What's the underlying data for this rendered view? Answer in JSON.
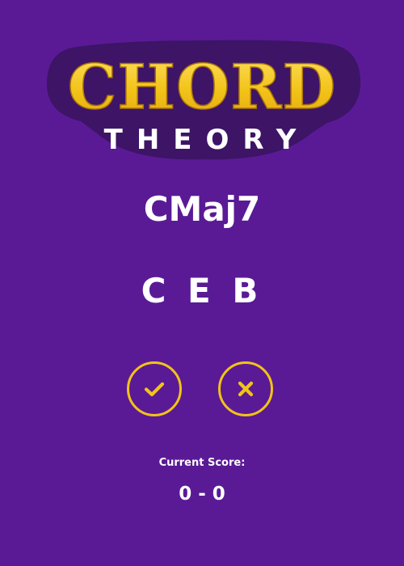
{
  "logo": {
    "title": "CHORD",
    "subtitle": "THEORY"
  },
  "chord": {
    "name": "CMaj7",
    "notes": "C E B"
  },
  "buttons": {
    "correct_icon": "check-icon",
    "wrong_icon": "close-icon"
  },
  "score": {
    "label": "Current Score:",
    "value": "0 - 0"
  },
  "colors": {
    "background": "#5a1a96",
    "logo_shadow": "#3d1466",
    "accent_yellow": "#f2c318",
    "text_white": "#ffffff"
  }
}
